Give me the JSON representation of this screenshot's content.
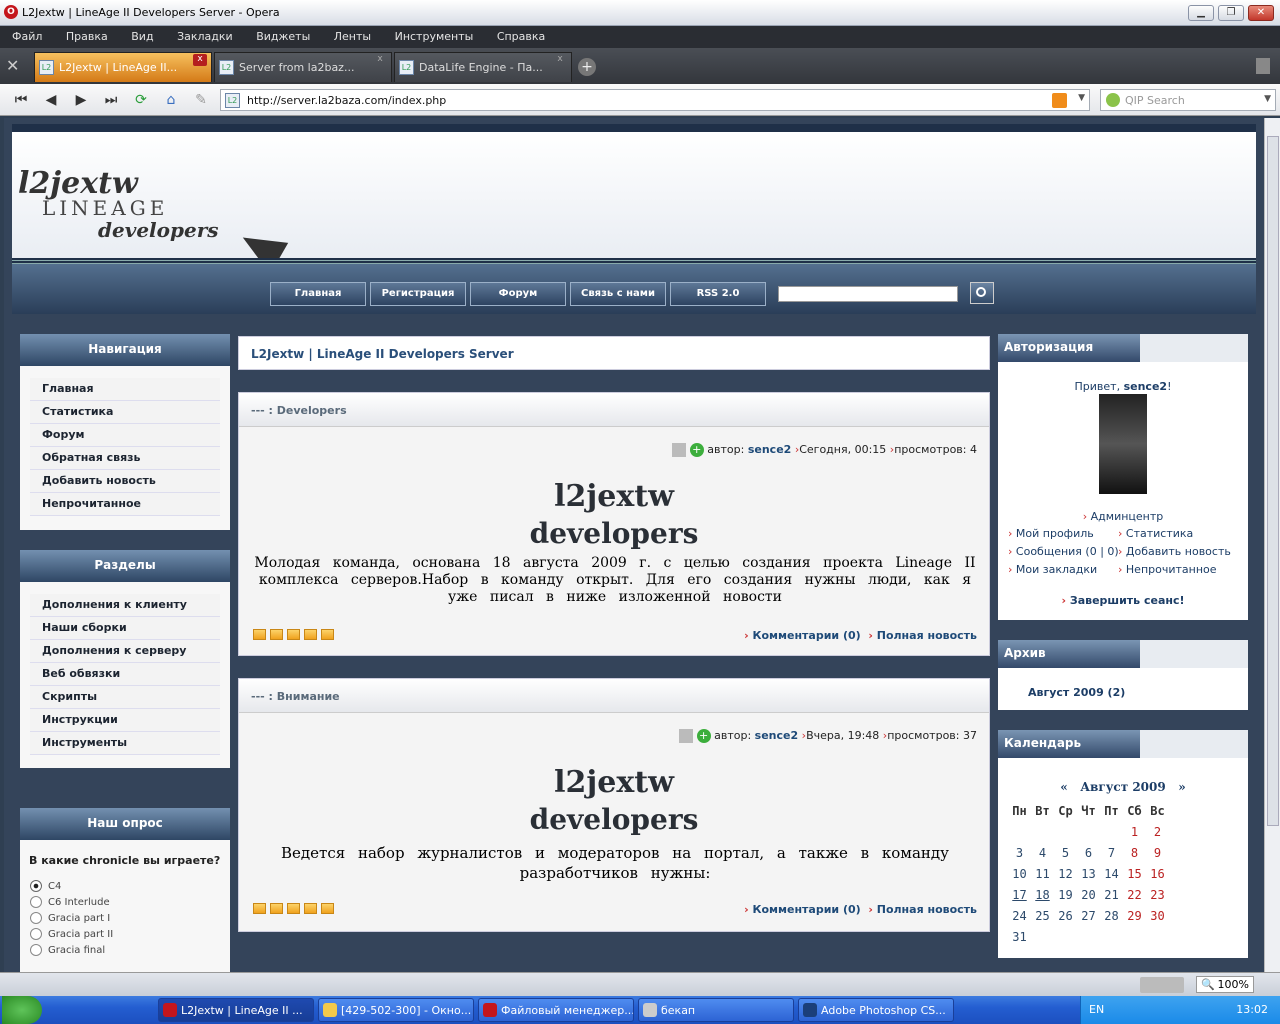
{
  "window": {
    "title": "L2Jextw | LineAge II Developers Server - Opera"
  },
  "menu": [
    "Файл",
    "Правка",
    "Вид",
    "Закладки",
    "Виджеты",
    "Ленты",
    "Инструменты",
    "Справка"
  ],
  "tabs": [
    {
      "label": "L2Jextw | LineAge II..."
    },
    {
      "label": "Server from la2baz..."
    },
    {
      "label": "DataLife Engine - Па..."
    }
  ],
  "address": {
    "url": "http://server.la2baza.com/index.php",
    "search_placeholder": "QIP Search"
  },
  "site": {
    "logo_line1": "l2jextw",
    "logo_line2": "LINEAGE",
    "logo_line3": "developers",
    "topnav": [
      "Главная",
      "Регистрация",
      "Форум",
      "Связь с нами",
      "RSS 2.0"
    ],
    "page_title": "L2Jextw | LineAge II Developers Server"
  },
  "left": {
    "nav": {
      "title": "Навигация",
      "items": [
        "Главная",
        "Статистика",
        "Форум",
        "Обратная связь",
        "Добавить новость",
        "Непрочитанное"
      ]
    },
    "sections": {
      "title": "Разделы",
      "items": [
        "Дополнения к клиенту",
        "Наши сборки",
        "Дополнения к серверу",
        "Веб обвязки",
        "Скрипты",
        "Инструкции",
        "Инструменты"
      ]
    },
    "poll": {
      "title": "Наш опрос",
      "question": "В какие chronicle вы играете?",
      "options": [
        "C4",
        "C6 Interlude",
        "Gracia part I",
        "Gracia part II",
        "Gracia final"
      ]
    }
  },
  "news": [
    {
      "category": "--- : Developers",
      "author_label": "автор:",
      "author": "sence2",
      "date": "Сегодня, 00:15",
      "views": "просмотров: 4",
      "banner1": "l2jextw",
      "banner2": "developers",
      "text": "Молодая команда, основана 18 августа 2009 г. с целью создания проекта Lineage II комплекса серверов.Набор в команду открыт. Для его создания нужны люди, как я уже писал в ниже изложенной новости",
      "comments": "Комментарии (0)",
      "more": "Полная новость"
    },
    {
      "category": "--- : Внимание",
      "author_label": "автор:",
      "author": "sence2",
      "date": "Вчера, 19:48",
      "views": "просмотров: 37",
      "banner1": "l2jextw",
      "banner2": "developers",
      "text": "Ведется набор журналистов и модераторов на портал, а также в команду разработчиков нужны:",
      "comments": "Комментарии (0)",
      "more": "Полная новость"
    }
  ],
  "right": {
    "auth": {
      "title": "Авторизация",
      "greeting": "Привет,",
      "user": "sence2",
      "greeting_end": "!",
      "admin": "Админцентр",
      "links": [
        "Мой профиль",
        "Статистика",
        "Сообщения (0 | 0)",
        "Добавить новость",
        "Мои закладки",
        "Непрочитанное"
      ],
      "logout": "Завершить сеанс!"
    },
    "archive": {
      "title": "Архив",
      "item": "Август 2009 (2)"
    },
    "calendar": {
      "title": "Календарь",
      "prev": "«",
      "month": "Август 2009",
      "next": "»",
      "weekdays": [
        "Пн",
        "Вт",
        "Ср",
        "Чт",
        "Пт",
        "Сб",
        "Вс"
      ],
      "weeks": [
        [
          "",
          "",
          "",
          "",
          "",
          "1",
          "2"
        ],
        [
          "3",
          "4",
          "5",
          "6",
          "7",
          "8",
          "9"
        ],
        [
          "10",
          "11",
          "12",
          "13",
          "14",
          "15",
          "16"
        ],
        [
          "17",
          "18",
          "19",
          "20",
          "21",
          "22",
          "23"
        ],
        [
          "24",
          "25",
          "26",
          "27",
          "28",
          "29",
          "30"
        ],
        [
          "31",
          "",
          "",
          "",
          "",
          "",
          ""
        ]
      ]
    }
  },
  "status": {
    "zoom": "100%"
  },
  "taskbar": {
    "tasks": [
      "L2Jextw | LineAge II ...",
      "[429-502-300] - Окно...",
      "Файловый менеджер...",
      "бекап",
      "Adobe Photoshop CS..."
    ],
    "lang": "EN",
    "clock": "13:02"
  },
  "colors": {
    "accent": "#2e4664",
    "link": "#1e4a78",
    "tab_active": "#e9922a"
  }
}
